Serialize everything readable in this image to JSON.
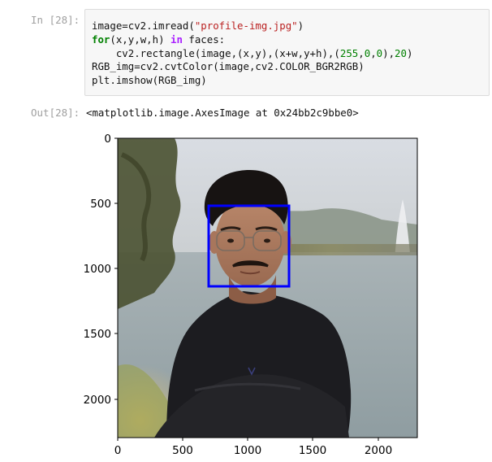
{
  "cell": {
    "in_prompt": "In [28]:",
    "out_prompt": "Out[28]:",
    "code_lines": [
      [
        {
          "t": "image=cv2.imread(",
          "c": "plain"
        },
        {
          "t": "\"profile-img.jpg\"",
          "c": "str"
        },
        {
          "t": ")",
          "c": "plain"
        }
      ],
      [
        {
          "t": "for",
          "c": "kw"
        },
        {
          "t": "(x,y,w,h) ",
          "c": "plain"
        },
        {
          "t": "in",
          "c": "op"
        },
        {
          "t": " faces:",
          "c": "plain"
        }
      ],
      [
        {
          "t": "    cv2.rectangle(image,(x,y),(x+w,y+h),(",
          "c": "plain"
        },
        {
          "t": "255",
          "c": "num"
        },
        {
          "t": ",",
          "c": "plain"
        },
        {
          "t": "0",
          "c": "num"
        },
        {
          "t": ",",
          "c": "plain"
        },
        {
          "t": "0",
          "c": "num"
        },
        {
          "t": "),",
          "c": "plain"
        },
        {
          "t": "20",
          "c": "num"
        },
        {
          "t": ")",
          "c": "plain"
        }
      ],
      [
        {
          "t": "RGB_img=cv2.cvtColor(image,cv2.COLOR_BGR2RGB)",
          "c": "plain"
        }
      ],
      [
        {
          "t": "plt.imshow(RGB_img)",
          "c": "plain"
        }
      ]
    ],
    "output_text": "<matplotlib.image.AxesImage at 0x24bb2c9bbe0>"
  },
  "plot": {
    "image_description_icon": "portrait-photo",
    "x_ticks": [
      "0",
      "500",
      "1000",
      "1500",
      "2000"
    ],
    "y_ticks": [
      "0",
      "500",
      "1000",
      "1500",
      "2000"
    ],
    "face_box_color": "#0000ff"
  },
  "colors": {
    "cell_bg": "#f7f7f7",
    "cell_border": "#dcdcdc",
    "prompt": "#a0a0a0"
  }
}
